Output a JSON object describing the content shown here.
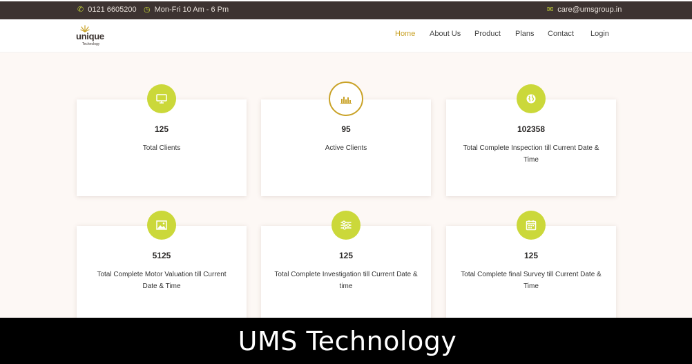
{
  "topbar": {
    "phone": "0121 6605200",
    "hours": "Mon-Fri 10 Am - 6 Pm",
    "email": "care@umsgroup.in"
  },
  "logo": {
    "word": "unique",
    "sub": "Technology"
  },
  "nav": {
    "items": [
      "Home",
      "About Us",
      "Product",
      "Plans",
      "Contact",
      "Login"
    ],
    "active_color": "#c9a227"
  },
  "stats": [
    {
      "icon": "monitor-icon",
      "value": "125",
      "label": "Total Clients"
    },
    {
      "icon": "bar-chart-icon",
      "value": "95",
      "label": "Active Clients"
    },
    {
      "icon": "globe-icon",
      "value": "102358",
      "label": "Total Complete Inspection till Current Date & Time"
    },
    {
      "icon": "image-icon",
      "value": "5125",
      "label": "Total Complete Motor Valuation till Current Date & Time"
    },
    {
      "icon": "sliders-icon",
      "value": "125",
      "label": "Total Complete Investigation till Current Date & time"
    },
    {
      "icon": "calendar-icon",
      "value": "125",
      "label": "Total Complete final Survey till Current Date & Time"
    }
  ],
  "colors": {
    "accent": "#cbd83a",
    "topbar_bg": "#3d3331",
    "page_bg": "#fdf8f5"
  },
  "banner": {
    "text": "UMS Technology"
  }
}
